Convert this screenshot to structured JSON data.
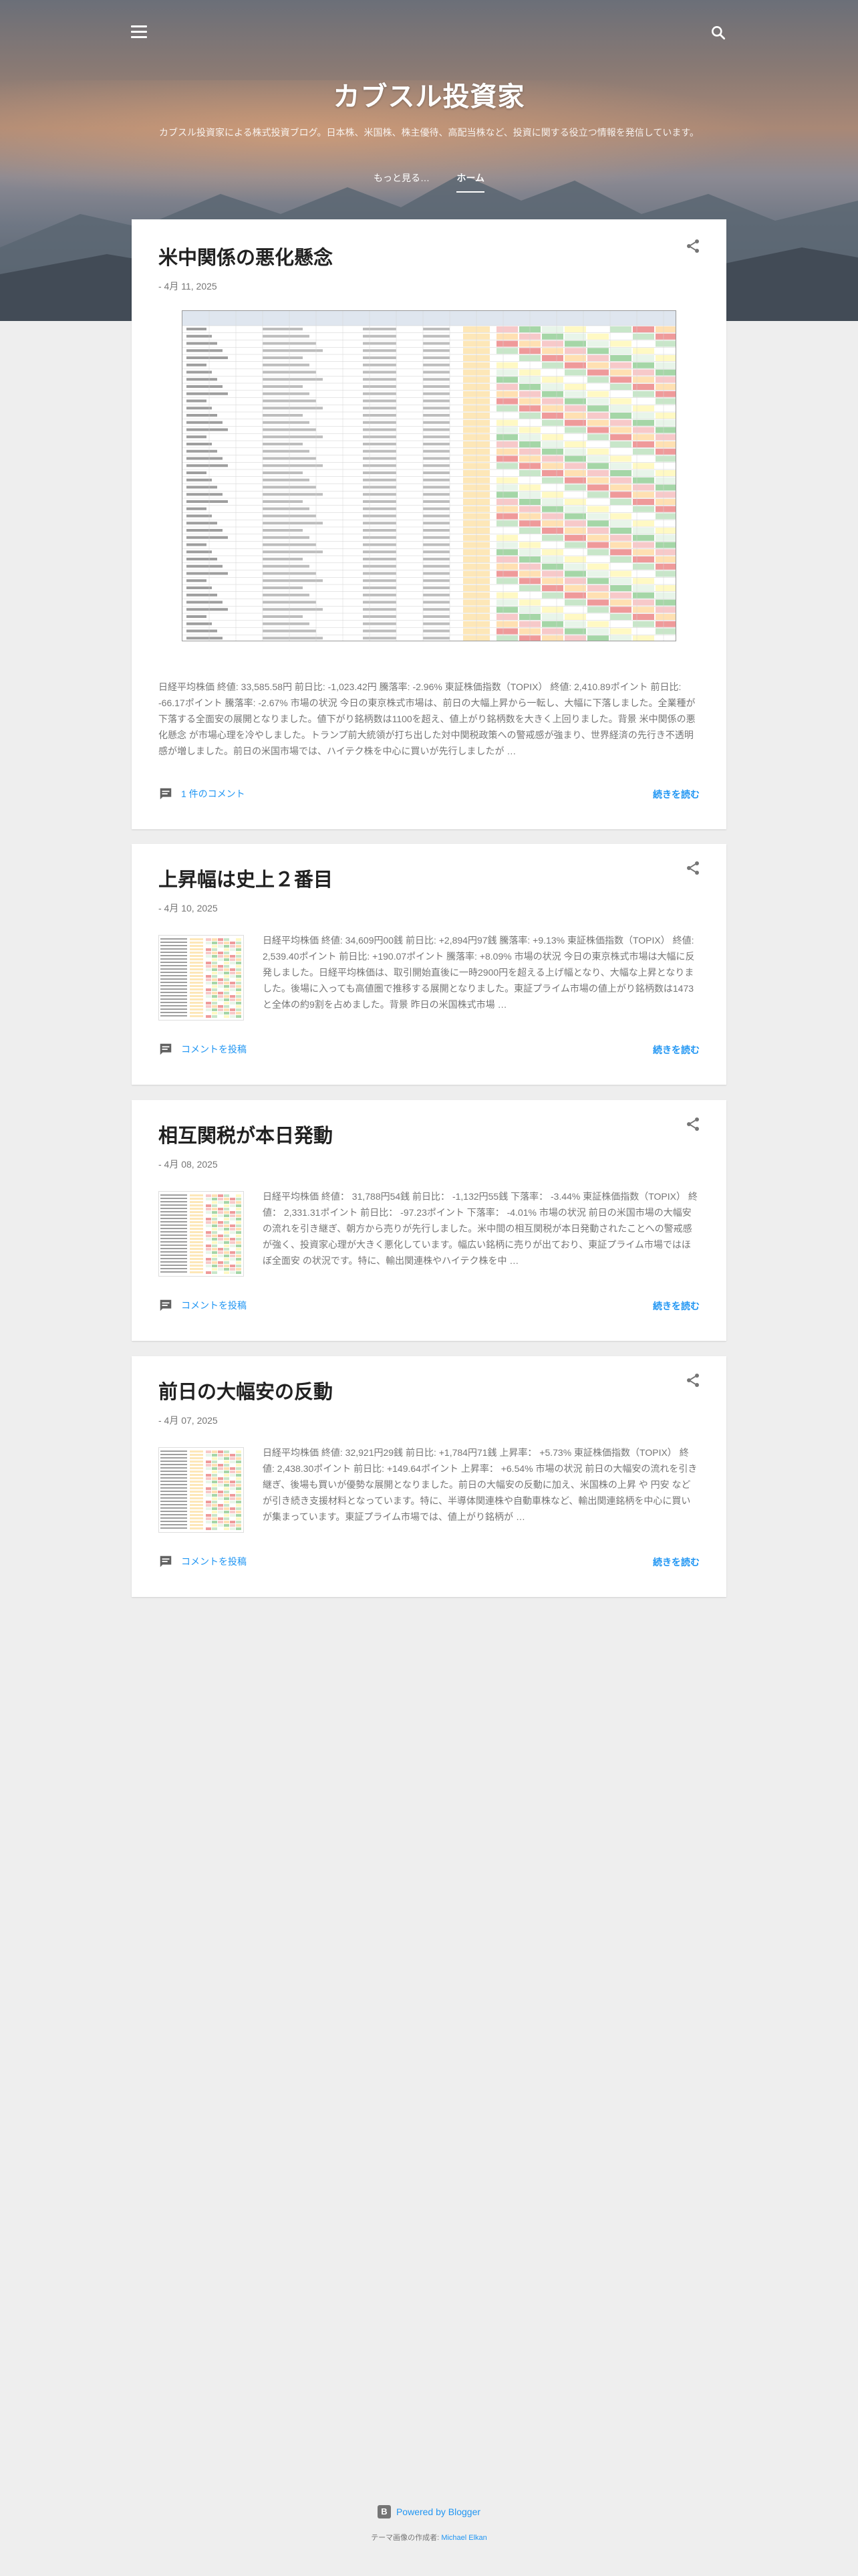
{
  "blog": {
    "title": "カブスル投資家",
    "description": "カブスル投資家による株式投資ブログ。日本株、米国株、株主優待、高配当株など、投資に関する役立つ情報を発信しています。"
  },
  "nav": {
    "more_label": "もっと見る…",
    "home_label": "ホーム"
  },
  "icons": {
    "menu": "hamburger-menu-icon",
    "search": "search-icon",
    "share": "share-icon",
    "comment": "comment-icon",
    "blogger": "blogger-icon"
  },
  "posts": [
    {
      "title": "米中関係の悪化懸念",
      "date": "- 4月 11, 2025",
      "snippet": "日経平均株価 終値: 33,585.58円 前日比: -1,023.42円 騰落率: -2.96% 東証株価指数（TOPIX） 終値: 2,410.89ポイント 前日比: -66.17ポイント 騰落率: -2.67% 市場の状況 今日の東京株式市場は、前日の大幅上昇から一転し、大幅に下落しました。全業種が下落する全面安の展開となりました。値下がり銘柄数は1100を超え、値上がり銘柄数を大きく上回りました。背景 米中関係の悪化懸念 が市場心理を冷やしました。トランプ前大統領が打ち出した対中関税政策への警戒感が強まり、世界経済の先行き不透明感が増しました。前日の米国市場では、ハイテク株を中心に買いが先行しましたが …",
      "comments": "1 件のコメント",
      "read_more": "続きを読む"
    },
    {
      "title": "上昇幅は史上２番目",
      "date": "- 4月 10, 2025",
      "snippet": "日経平均株価 終値: 34,609円00銭 前日比: +2,894円97銭 騰落率: +9.13% 東証株価指数（TOPIX） 終値: 2,539.40ポイント 前日比: +190.07ポイント 騰落率: +8.09% 市場の状況 今日の東京株式市場は大幅に反発しました。日経平均株価は、取引開始直後に一時2900円を超える上げ幅となり、大幅な上昇となりました。後場に入っても高値圏で推移する展開となりました。東証プライム市場の値上がり銘柄数は1473と全体の約9割を占めました。背景 昨日の米国株式市場 …",
      "comments": "コメントを投稿",
      "read_more": "続きを読む"
    },
    {
      "title": "相互関税が本日発動",
      "date": "- 4月 08, 2025",
      "snippet": "日経平均株価 終値： 31,788円54銭 前日比： -1,132円55銭 下落率： -3.44% 東証株価指数（TOPIX） 終値： 2,331.31ポイント 前日比： -97.23ポイント 下落率： -4.01% 市場の状況 前日の米国市場の大幅安の流れを引き継ぎ、朝方から売りが先行しました。米中間の相互関税が本日発動されたことへの警戒感が強く、投資家心理が大きく悪化しています。幅広い銘柄に売りが出ており、東証プライム市場ではほぼ全面安 の状況です。特に、輸出関連株やハイテク株を中 …",
      "comments": "コメントを投稿",
      "read_more": "続きを読む"
    },
    {
      "title": "前日の大幅安の反動",
      "date": "- 4月 07, 2025",
      "snippet": "日経平均株価 終値: 32,921円29銭 前日比: +1,784円71銭 上昇率： +5.73% 東証株価指数（TOPIX） 終値: 2,438.30ポイント 前日比: +149.64ポイント 上昇率： +6.54% 市場の状況 前日の大幅安の流れを引き継ぎ、後場も買いが優勢な展開となりました。前日の大幅安の反動に加え、米国株の上昇 や 円安 などが引き続き支援材料となっています。特に、半導体関連株や自動車株など、輸出関連銘柄を中心に買いが集まっています。東証プライム市場では、値上がり銘柄が …",
      "comments": "コメントを投稿",
      "read_more": "続きを読む"
    }
  ],
  "footer": {
    "powered_by": "Powered by Blogger",
    "theme_prefix": "テーマ画像の作成者: ",
    "theme_author": "Michael Elkan"
  },
  "colors": {
    "accent": "#2196f3",
    "title": "#212121",
    "meta": "#757575",
    "background": "#eeeeee"
  }
}
